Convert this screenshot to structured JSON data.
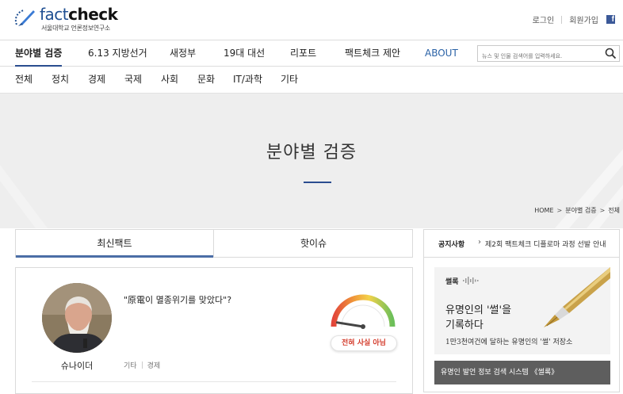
{
  "header": {
    "logo_word_1": "fact",
    "logo_word_2": "check",
    "logo_sub": "서울대학교 언론정보연구소",
    "login": "로그인",
    "signup": "회원가입",
    "facebook_icon": "facebook-icon"
  },
  "main_nav": {
    "items": [
      "분야별 검증",
      "6.13 지방선거",
      "새정부",
      "19대 대선",
      "리포트",
      "팩트체크 제안",
      "ABOUT"
    ],
    "active": "분야별 검증",
    "search_placeholder": "뉴스 및 인물 검색어를 입력하세요."
  },
  "sub_nav": {
    "items": [
      "전체",
      "정치",
      "경제",
      "국제",
      "사회",
      "문화",
      "IT/과학",
      "기타"
    ]
  },
  "hero": {
    "title": "분야별 검증",
    "breadcrumb": [
      "HOME",
      "분야별 검증",
      "전체"
    ]
  },
  "tabs": {
    "latest": "최신팩트",
    "hot": "핫이슈"
  },
  "card": {
    "quote": "\"原電이 멸종위기를 맞았다\"?",
    "person": "슈나이더",
    "tags": [
      "기타",
      "경제"
    ],
    "verdict": "전혀 사실 아님",
    "gauge_level": 0.05
  },
  "notice": {
    "label": "공지사항",
    "text": "제2회 팩트체크 디플로마 과정 선발 안내"
  },
  "banner": {
    "logo": "썰록",
    "title_line1": "유명인의 '썰'을",
    "title_line2": "기록하다",
    "sub": "1만3천여건에 달하는 유명인의 '썰' 저장소",
    "bar": "유명인 발언 정보 검색 시스템 《썰록》"
  },
  "colors": {
    "brand_blue": "#2a4d8f",
    "verdict_red": "#d33a2a",
    "facebook": "#3b5998"
  }
}
